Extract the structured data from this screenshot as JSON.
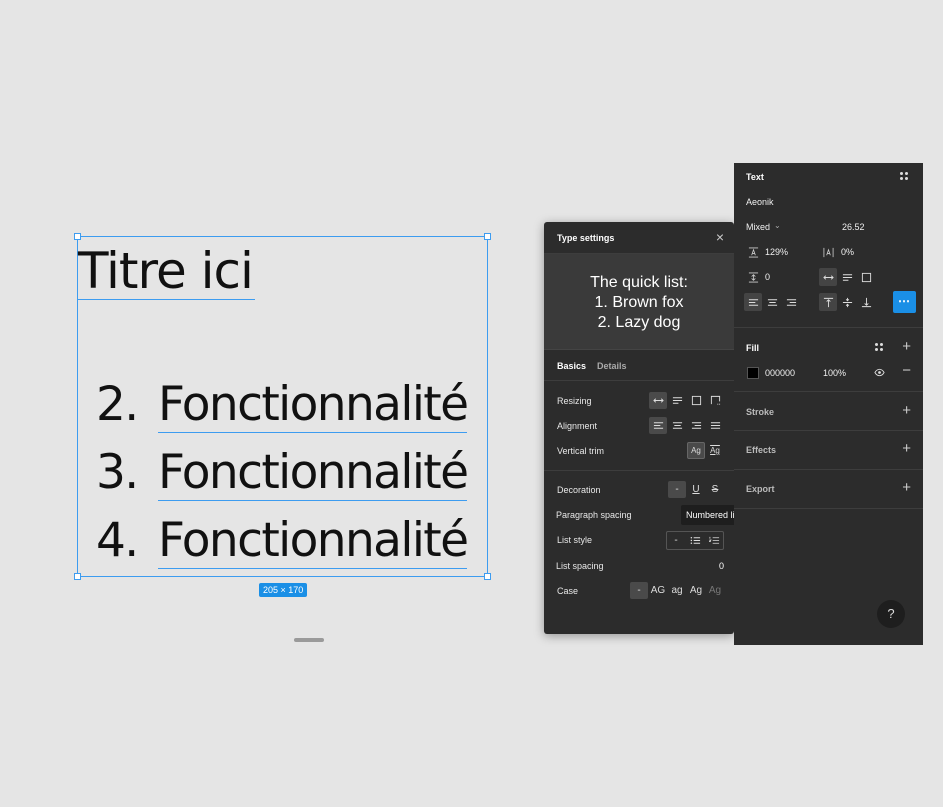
{
  "canvas": {
    "title": "Titre ici",
    "items": [
      {
        "num": "2.",
        "text": "Fonctionnalité"
      },
      {
        "num": "3.",
        "text": "Fonctionnalité"
      },
      {
        "num": "4.",
        "text": "Fonctionnalité"
      }
    ],
    "size_badge": "205 × 170"
  },
  "type_settings": {
    "title": "Type settings",
    "close": "×",
    "preview": [
      "The quick list:",
      "1. Brown fox",
      "2. Lazy dog"
    ],
    "tabs": {
      "basics": "Basics",
      "details": "Details"
    },
    "resizing_label": "Resizing",
    "alignment_label": "Alignment",
    "vertical_trim_label": "Vertical trim",
    "vertical_trim_options": [
      "Ag",
      "Ag"
    ],
    "decoration_label": "Decoration",
    "decoration_none": "-",
    "decoration_underline": "U",
    "decoration_strike": "S",
    "paragraph_spacing_label": "Paragraph spacing",
    "list_style_label": "List style",
    "list_style_none": "-",
    "list_spacing_label": "List spacing",
    "list_spacing_value": "0",
    "case_label": "Case",
    "case_options": [
      "-",
      "AG",
      "ag",
      "Ag",
      "Ag"
    ],
    "tooltip": "Numbered list"
  },
  "properties": {
    "text_section": "Text",
    "font_family": "Aeonik",
    "font_weight": "Mixed",
    "font_size": "26.52",
    "line_height": "129%",
    "letter_spacing": "0%",
    "paragraph_spacing": "0",
    "more": "⋯",
    "fill_section": "Fill",
    "fill_hex": "000000",
    "fill_opacity": "100%",
    "stroke_section": "Stroke",
    "effects_section": "Effects",
    "export_section": "Export",
    "help": "?"
  },
  "colors": {
    "accent": "#1a8fe6",
    "selection": "#3d9cf0",
    "panel": "#2c2c2c",
    "canvas": "#e5e5e5"
  }
}
